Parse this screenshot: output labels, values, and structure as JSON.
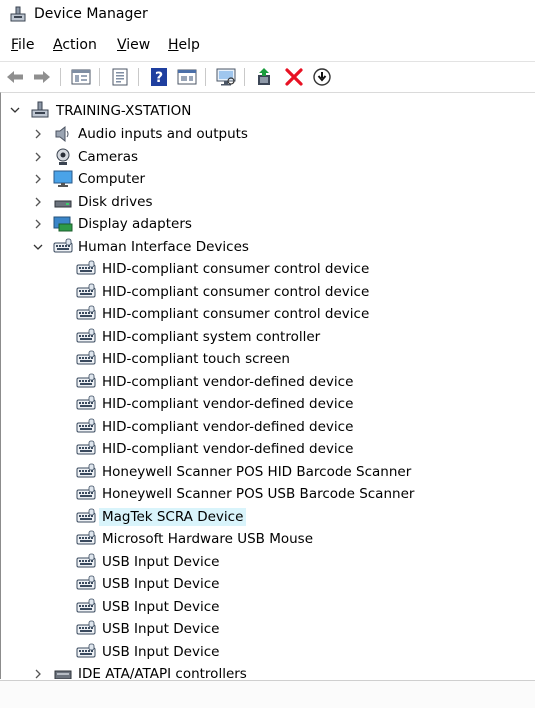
{
  "window": {
    "title": "Device Manager",
    "icon": "device-manager-icon"
  },
  "menu": {
    "file": {
      "u": "F",
      "rest": "ile"
    },
    "action": {
      "u": "A",
      "rest": "ction"
    },
    "view": {
      "u": "V",
      "rest": "iew"
    },
    "help": {
      "u": "H",
      "rest": "elp"
    }
  },
  "toolbar": {
    "icons": [
      "back-arrow-icon",
      "forward-arrow-icon",
      "properties-icon",
      "document-icon",
      "help-icon",
      "show-hidden-icon",
      "monitor-scan-icon",
      "update-driver-icon",
      "uninstall-x-icon",
      "download-icon"
    ]
  },
  "tree": {
    "root": "TRAINING-XSTATION",
    "categories": {
      "audio": "Audio inputs and outputs",
      "cameras": "Cameras",
      "computer": "Computer",
      "disk": "Disk drives",
      "display": "Display adapters",
      "hid": "Human Interface Devices",
      "ide": "IDE ATA/ATAPI controllers"
    },
    "hid_devices": [
      "HID-compliant consumer control device",
      "HID-compliant consumer control device",
      "HID-compliant consumer control device",
      "HID-compliant system controller",
      "HID-compliant touch screen",
      "HID-compliant vendor-defined device",
      "HID-compliant vendor-defined device",
      "HID-compliant vendor-defined device",
      "HID-compliant vendor-defined device",
      "Honeywell Scanner POS HID Barcode Scanner",
      "Honeywell Scanner POS USB Barcode Scanner",
      "MagTek SCRA Device",
      "Microsoft Hardware USB Mouse",
      "USB Input Device",
      "USB Input Device",
      "USB Input Device",
      "USB Input Device",
      "USB Input Device"
    ],
    "selected": "MagTek SCRA Device"
  },
  "colors": {
    "selection": "#d9f4fb",
    "uninstall": "#e81123",
    "update": "#1a9c3c",
    "help": "#1f3f9f"
  }
}
